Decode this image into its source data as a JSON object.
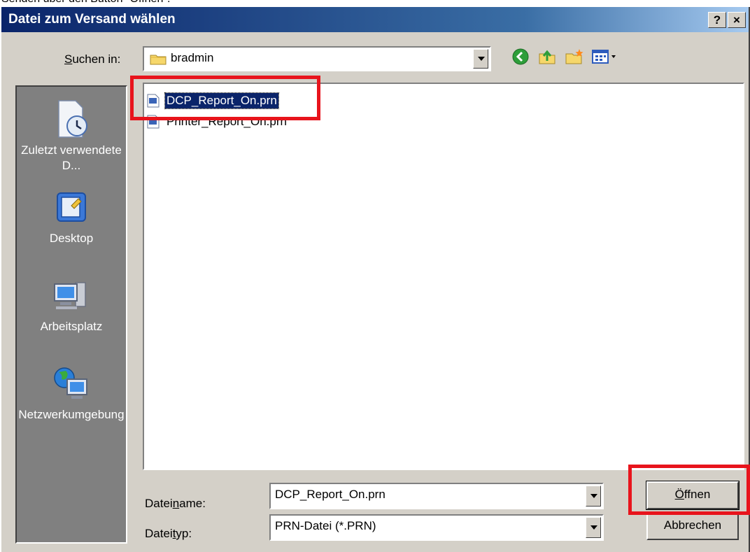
{
  "caption": "Senden über den Button \"Öffnen\".",
  "dialog": {
    "title": "Datei zum Versand wählen",
    "help_button": "?",
    "close_button": "×"
  },
  "lookin": {
    "label_accel": "S",
    "label_rest": "uchen in:",
    "folder": "bradmin"
  },
  "toolbar": {
    "icons": [
      "back-icon",
      "up-folder-icon",
      "new-folder-icon",
      "view-menu-icon"
    ]
  },
  "places": [
    {
      "label": "Zuletzt verwendete D...",
      "icon": "recent-documents-icon"
    },
    {
      "label": "Desktop",
      "icon": "desktop-icon"
    },
    {
      "label": "Arbeitsplatz",
      "icon": "my-computer-icon"
    },
    {
      "label": "Netzwerkumgebung",
      "icon": "network-icon"
    }
  ],
  "files": [
    {
      "name": "DCP_Report_On.prn",
      "selected": true
    },
    {
      "name": "Printer_Report_On.prn",
      "selected": false
    }
  ],
  "filename": {
    "label_pre": "Datei",
    "label_accel": "n",
    "label_post": "ame:",
    "value": "DCP_Report_On.prn"
  },
  "filetype": {
    "label_pre": "Datei",
    "label_accel": "t",
    "label_post": "yp:",
    "value": "PRN-Datei (*.PRN)"
  },
  "buttons": {
    "open_accel": "Ö",
    "open_rest": "ffnen",
    "cancel": "Abbrechen"
  },
  "colors": {
    "highlight": "#e8141c",
    "title_bar": "#0a246a",
    "selection": "#0a246a"
  }
}
